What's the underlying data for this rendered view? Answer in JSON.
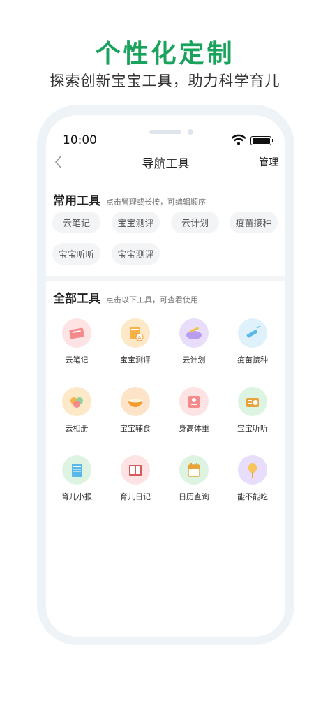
{
  "promo": {
    "title": "个性化定制",
    "subtitle": "探索创新宝宝工具，助力科学育儿"
  },
  "status_bar": {
    "time": "10:00"
  },
  "nav": {
    "title": "导航工具",
    "action": "管理"
  },
  "common_tools": {
    "title": "常用工具",
    "hint": "点击管理或长按，可编辑顺序",
    "chips": [
      "云笔记",
      "宝宝测评",
      "云计划",
      "疫苗接种",
      "宝宝听听",
      "宝宝测评"
    ]
  },
  "all_tools": {
    "title": "全部工具",
    "hint": "点击以下工具，可查看使用",
    "items": [
      {
        "label": "云笔记",
        "icon": "cloud-notes-icon",
        "color": "#fde3e3"
      },
      {
        "label": "宝宝测评",
        "icon": "baby-assessment-icon",
        "color": "#fde9c8"
      },
      {
        "label": "云计划",
        "icon": "cloud-plan-icon",
        "color": "#e8ddfa"
      },
      {
        "label": "疫苗接种",
        "icon": "vaccine-icon",
        "color": "#dff1fb"
      },
      {
        "label": "云相册",
        "icon": "cloud-album-icon",
        "color": "#fde9c8"
      },
      {
        "label": "宝宝辅食",
        "icon": "baby-food-icon",
        "color": "#fde3c8"
      },
      {
        "label": "身高体重",
        "icon": "height-weight-icon",
        "color": "#fde3e3"
      },
      {
        "label": "宝宝听听",
        "icon": "radio-icon",
        "color": "#def4e2"
      },
      {
        "label": "育儿小报",
        "icon": "newspaper-icon",
        "color": "#def4e2"
      },
      {
        "label": "育儿日记",
        "icon": "diary-icon",
        "color": "#fde3e3"
      },
      {
        "label": "日历查询",
        "icon": "calendar-icon",
        "color": "#def4e2"
      },
      {
        "label": "能不能吃",
        "icon": "can-eat-icon",
        "color": "#e8ddfa"
      }
    ]
  },
  "colors": {
    "brand_green": "#1aa35c"
  }
}
